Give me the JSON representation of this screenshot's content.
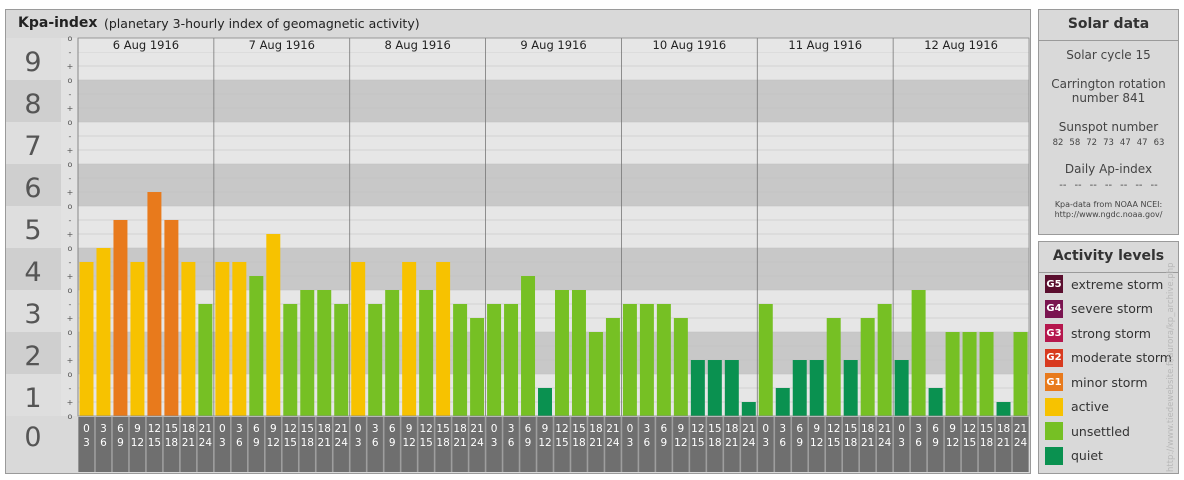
{
  "header": {
    "title": "Kpa-index",
    "subtitle": "(planetary 3-hourly index of geomagnetic activity)"
  },
  "chart_data": {
    "type": "bar",
    "ylim": [
      0,
      9
    ],
    "y_tick_labels": [
      "0",
      "1",
      "2",
      "3",
      "4",
      "5",
      "6",
      "7",
      "8",
      "9"
    ],
    "minor_tick_labels": [
      "-",
      "o",
      "+"
    ],
    "days": [
      "6 Aug 1916",
      "7 Aug 1916",
      "8 Aug 1916",
      "9 Aug 1916",
      "10 Aug 1916",
      "11 Aug 1916",
      "12 Aug 1916"
    ],
    "interval_labels": [
      {
        "start": "0",
        "end": "3"
      },
      {
        "start": "3",
        "end": "6"
      },
      {
        "start": "6",
        "end": "9"
      },
      {
        "start": "9",
        "end": "12"
      },
      {
        "start": "12",
        "end": "15"
      },
      {
        "start": "15",
        "end": "18"
      },
      {
        "start": "18",
        "end": "21"
      },
      {
        "start": "21",
        "end": "24"
      }
    ],
    "values": [
      [
        3.667,
        4.0,
        4.667,
        3.667,
        5.333,
        4.667,
        3.667,
        2.667
      ],
      [
        3.667,
        3.667,
        3.333,
        4.333,
        2.667,
        3.0,
        3.0,
        2.667
      ],
      [
        3.667,
        2.667,
        3.0,
        3.667,
        3.0,
        3.667,
        2.667,
        2.333
      ],
      [
        2.667,
        2.667,
        3.333,
        0.667,
        3.0,
        3.0,
        2.0,
        2.333
      ],
      [
        2.667,
        2.667,
        2.667,
        2.333,
        1.333,
        1.333,
        1.333,
        0.333
      ],
      [
        2.667,
        0.667,
        1.333,
        1.333,
        2.333,
        1.333,
        2.333,
        2.667
      ],
      [
        1.333,
        3.0,
        0.667,
        2.0,
        2.0,
        2.0,
        0.333,
        2.0
      ]
    ]
  },
  "solar": {
    "title": "Solar data",
    "cycle": "Solar cycle 15",
    "carrington_1": "Carrington rotation",
    "carrington_2": "number 841",
    "sunspot_title": "Sunspot number",
    "sunspots": [
      "82",
      "58",
      "72",
      "73",
      "47",
      "47",
      "63"
    ],
    "ap_title": "Daily Ap-index",
    "ap_values": [
      "--",
      "--",
      "--",
      "--",
      "--",
      "--",
      "--"
    ],
    "source_1": "Kpa-data from NOAA NCEI:",
    "source_2": "http://www.ngdc.noaa.gov/"
  },
  "levels": {
    "title": "Activity levels",
    "items": [
      {
        "badge": "G5",
        "label": "extreme storm",
        "color": "#5a0e2e"
      },
      {
        "badge": "G4",
        "label": "severe storm",
        "color": "#7a1450"
      },
      {
        "badge": "G3",
        "label": "strong storm",
        "color": "#b5174d"
      },
      {
        "badge": "G2",
        "label": "moderate storm",
        "color": "#d83a1f"
      },
      {
        "badge": "G1",
        "label": "minor storm",
        "color": "#e87a1c"
      },
      {
        "badge": "",
        "label": "active",
        "color": "#f7c200"
      },
      {
        "badge": "",
        "label": "unsettled",
        "color": "#76c024"
      },
      {
        "badge": "",
        "label": "quiet",
        "color": "#0a9150"
      }
    ]
  },
  "watermark": "http://www.tiedewebsite.fi/aurora/kp_archive.php"
}
